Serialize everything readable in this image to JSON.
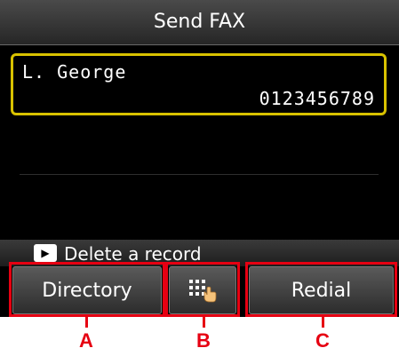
{
  "screen": {
    "title": "Send FAX",
    "record": {
      "name": "L. George",
      "number": "0123456789"
    },
    "hint": {
      "icon": "play-button-icon",
      "text": "Delete a record"
    }
  },
  "softkeys": {
    "directory": "Directory",
    "keypad_icon": "keypad-touch-icon",
    "redial": "Redial"
  },
  "callouts": {
    "a": "A",
    "b": "B",
    "c": "C"
  },
  "colors": {
    "highlight": "#d9c200",
    "callout_red": "#e60012"
  }
}
